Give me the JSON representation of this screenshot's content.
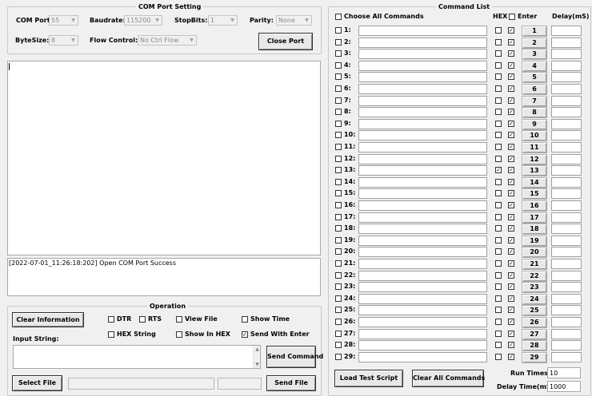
{
  "com_port_setting": {
    "title": "COM Port Setting",
    "com_port_label": "COM Port:",
    "com_port_value": "55",
    "baudrate_label": "Baudrate:",
    "baudrate_value": "115200",
    "stopbits_label": "StopBits:",
    "stopbits_value": "1",
    "parity_label": "Parity:",
    "parity_value": "None",
    "bytesize_label": "ByteSize:",
    "bytesize_value": "8",
    "flow_control_label": "Flow Control:",
    "flow_control_value": "No Ctrl Flow",
    "close_port_label": "Close Port"
  },
  "log": {
    "line": "[2022-07-01_11:26:18:202] Open COM Port Success"
  },
  "operation": {
    "title": "Operation",
    "clear_information_label": "Clear Information",
    "dtr_label": "DTR",
    "dtr_checked": false,
    "rts_label": "RTS",
    "rts_checked": false,
    "view_file_label": "View File",
    "view_file_checked": false,
    "show_time_label": "Show Time",
    "show_time_checked": false,
    "hex_string_label": "HEX String",
    "hex_string_checked": false,
    "show_in_hex_label": "Show In HEX",
    "show_in_hex_checked": false,
    "send_with_enter_label": "Send With Enter",
    "send_with_enter_checked": true,
    "input_string_label": "Input String:",
    "input_string_value": "",
    "send_command_label": "Send Command",
    "select_file_label": "Select File",
    "send_file_label": "Send File"
  },
  "command_list": {
    "title": "Command List",
    "choose_all_label": "Choose All Commands",
    "hex_header": "HEX",
    "enter_header": "Enter",
    "delay_header": "Delay(mS)",
    "rows": [
      {
        "label": "1:",
        "hex": false,
        "enter": true,
        "button": "1"
      },
      {
        "label": "2:",
        "hex": false,
        "enter": true,
        "button": "2"
      },
      {
        "label": "3:",
        "hex": false,
        "enter": true,
        "button": "3"
      },
      {
        "label": "4:",
        "hex": false,
        "enter": true,
        "button": "4"
      },
      {
        "label": "5:",
        "hex": false,
        "enter": true,
        "button": "5"
      },
      {
        "label": "6:",
        "hex": false,
        "enter": true,
        "button": "6"
      },
      {
        "label": "7:",
        "hex": false,
        "enter": true,
        "button": "7"
      },
      {
        "label": "8:",
        "hex": false,
        "enter": true,
        "button": "8"
      },
      {
        "label": "9:",
        "hex": false,
        "enter": true,
        "button": "9"
      },
      {
        "label": "10:",
        "hex": false,
        "enter": true,
        "button": "10"
      },
      {
        "label": "11:",
        "hex": false,
        "enter": true,
        "button": "11"
      },
      {
        "label": "12:",
        "hex": false,
        "enter": true,
        "button": "12"
      },
      {
        "label": "13:",
        "hex": true,
        "enter": true,
        "button": "13"
      },
      {
        "label": "14:",
        "hex": false,
        "enter": true,
        "button": "14"
      },
      {
        "label": "15:",
        "hex": false,
        "enter": true,
        "button": "15"
      },
      {
        "label": "16:",
        "hex": false,
        "enter": true,
        "button": "16"
      },
      {
        "label": "17:",
        "hex": false,
        "enter": true,
        "button": "17"
      },
      {
        "label": "18:",
        "hex": false,
        "enter": true,
        "button": "18"
      },
      {
        "label": "19:",
        "hex": false,
        "enter": true,
        "button": "19"
      },
      {
        "label": "20:",
        "hex": false,
        "enter": true,
        "button": "20"
      },
      {
        "label": "21:",
        "hex": false,
        "enter": true,
        "button": "21"
      },
      {
        "label": "22:",
        "hex": false,
        "enter": true,
        "button": "22"
      },
      {
        "label": "23:",
        "hex": false,
        "enter": true,
        "button": "23"
      },
      {
        "label": "24:",
        "hex": false,
        "enter": true,
        "button": "24"
      },
      {
        "label": "25:",
        "hex": false,
        "enter": true,
        "button": "25"
      },
      {
        "label": "26:",
        "hex": false,
        "enter": true,
        "button": "26"
      },
      {
        "label": "27:",
        "hex": false,
        "enter": true,
        "button": "27"
      },
      {
        "label": "28:",
        "hex": false,
        "enter": true,
        "button": "28"
      },
      {
        "label": "29:",
        "hex": false,
        "enter": true,
        "button": "29"
      }
    ],
    "load_test_script_label": "Load Test Script",
    "clear_all_commands_label": "Clear All Commands",
    "run_times_label": "Run Times:",
    "run_times_value": "10",
    "delay_time_label": "Delay Time(mS):",
    "delay_time_value": "1000"
  },
  "icons": {
    "check_glyph": "✓",
    "dropdown_arrow": "▼",
    "scroll_up": "▲",
    "scroll_down": "▼"
  }
}
